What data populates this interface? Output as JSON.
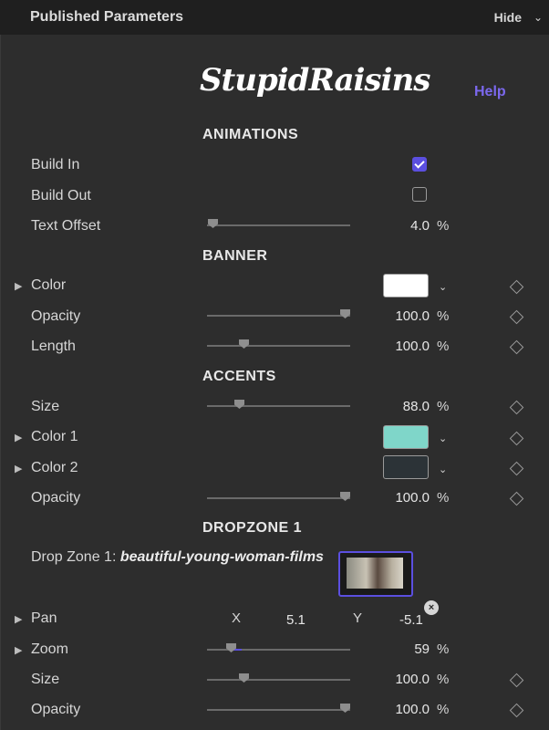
{
  "header": {
    "title": "Published Parameters",
    "hide_label": "Hide"
  },
  "logo_text": "StupidRaisins",
  "help_label": "Help",
  "sections": {
    "animations": "ANIMATIONS",
    "banner": "BANNER",
    "accents": "ACCENTS",
    "dropzone": "DROPZONE 1"
  },
  "animations": {
    "build_in": {
      "label": "Build In",
      "checked": true
    },
    "build_out": {
      "label": "Build Out",
      "checked": false
    },
    "text_offset": {
      "label": "Text Offset",
      "value": "4.0",
      "unit": "%",
      "slider_fraction": 0.05
    }
  },
  "banner": {
    "color": {
      "label": "Color",
      "swatch": "#ffffff"
    },
    "opacity": {
      "label": "Opacity",
      "value": "100.0",
      "unit": "%",
      "slider_fraction": 1.0
    },
    "length": {
      "label": "Length",
      "value": "100.0",
      "unit": "%",
      "slider_fraction": 0.25
    }
  },
  "accents": {
    "size": {
      "label": "Size",
      "value": "88.0",
      "unit": "%",
      "slider_fraction": 0.22
    },
    "color1": {
      "label": "Color 1",
      "swatch": "#7fd6c9"
    },
    "color2": {
      "label": "Color 2",
      "swatch": "#2c3337"
    },
    "opacity": {
      "label": "Opacity",
      "value": "100.0",
      "unit": "%",
      "slider_fraction": 1.0
    }
  },
  "dropzone": {
    "label_prefix": "Drop Zone 1:",
    "file_name": "beautiful-young-woman-films",
    "pan": {
      "label": "Pan",
      "x_label": "X",
      "x_value": "5.1",
      "y_label": "Y",
      "y_value": "-5.1"
    },
    "zoom": {
      "label": "Zoom",
      "value": "59",
      "unit": "%",
      "slider_fraction": 0.16
    },
    "size": {
      "label": "Size",
      "value": "100.0",
      "unit": "%",
      "slider_fraction": 0.25
    },
    "opacity": {
      "label": "Opacity",
      "value": "100.0",
      "unit": "%",
      "slider_fraction": 1.0
    }
  },
  "colors": {
    "accent": "#5b4fe0",
    "help": "#7b68ee"
  }
}
